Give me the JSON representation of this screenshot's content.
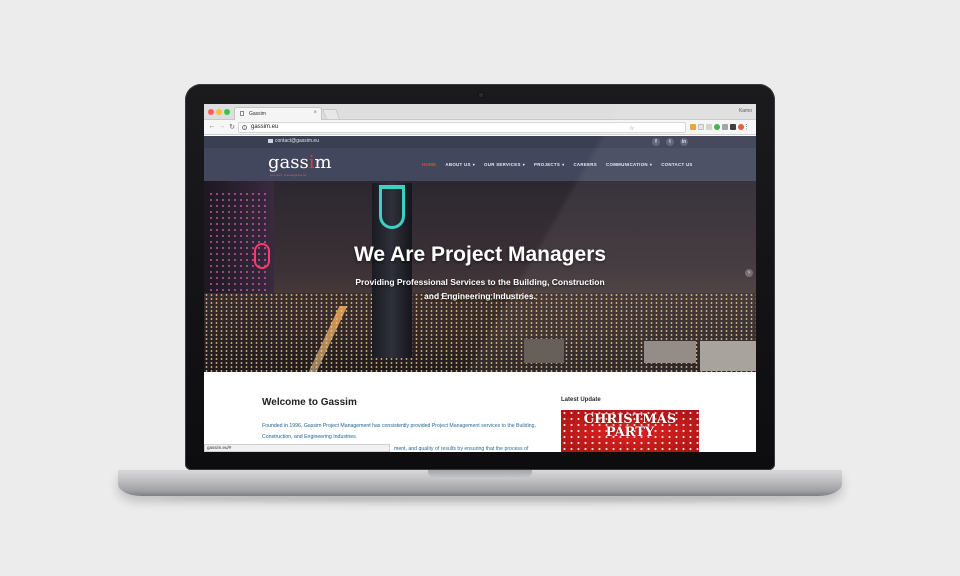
{
  "browser": {
    "tab_title": "Gassim",
    "tab_close": "×",
    "user_name": "Kamo",
    "url": "gassim.eu",
    "status_url": "gassim.eu/#"
  },
  "site": {
    "contact_email": "contact@gassim.eu",
    "social_icons": [
      "facebook-icon",
      "twitter-icon",
      "linkedin-icon"
    ],
    "social_glyphs": [
      "f",
      "t",
      "in"
    ],
    "logo_text_pre": "gass",
    "logo_text_accent": "i",
    "logo_text_post": "m",
    "logo_tagline": "project management",
    "menu": [
      {
        "label": "HOME",
        "active": true
      },
      {
        "label": "ABOUT US",
        "dropdown": true
      },
      {
        "label": "OUR SERVICES",
        "dropdown": true
      },
      {
        "label": "PROJECTS",
        "dropdown": true
      },
      {
        "label": "CAREERS"
      },
      {
        "label": "COMMUNICATION",
        "dropdown": true
      },
      {
        "label": "CONTACT US"
      }
    ],
    "hero": {
      "title": "We Are Project Managers",
      "subtitle": "Providing Professional Services to the Building, Construction and Engineering Industries."
    },
    "welcome": {
      "title": "Welcome to Gassim",
      "body": "Founded in 1996, Gassim Project Management has consistently provided Project Management services to the Building, Construction, and Engineering Industries.",
      "body_partial": "ment, and quality of results by ensuring that the process of"
    },
    "latest": {
      "title": "Latest Update",
      "image_text_line1": "CHRISTMAS",
      "image_text_line2": "PARTY"
    }
  },
  "colors": {
    "header_bg": "#3a3f56",
    "accent_red": "#e04848",
    "link_blue": "#1a5f91"
  }
}
